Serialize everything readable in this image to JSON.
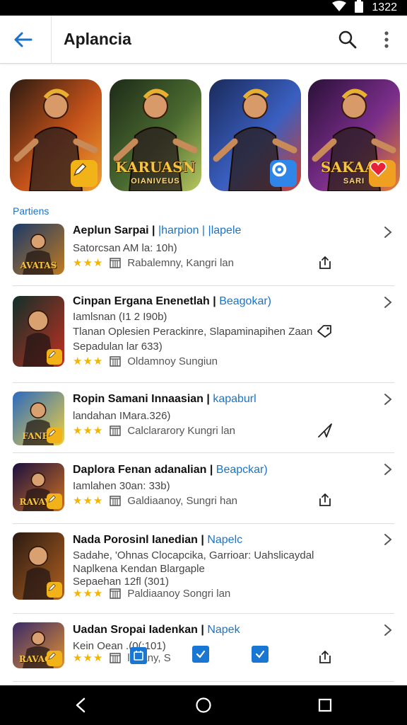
{
  "status_bar": {
    "time": "1322"
  },
  "app_bar": {
    "title": "Aplancia"
  },
  "banners": [
    {
      "text": "",
      "sub": "",
      "badge": "pen-icon",
      "badge_color": "#f2b318",
      "bg": [
        "#2a1a12",
        "#c4521a",
        "#f0a030"
      ]
    },
    {
      "text": "KARUASN",
      "sub": "OIANIVEUS",
      "badge": "",
      "badge_color": "",
      "bg": [
        "#1d2a18",
        "#4a6a30",
        "#b8c860"
      ]
    },
    {
      "text": "",
      "sub": "",
      "badge": "gear-icon",
      "badge_color": "#2f86e8",
      "bg": [
        "#1a2a5a",
        "#3a5fc0",
        "#d04030"
      ]
    },
    {
      "text": "SAKAAR",
      "sub": "SARI",
      "badge": "heart-icon",
      "badge_color": "#f0a020",
      "bg": [
        "#2a1038",
        "#7a2e8a",
        "#e88030"
      ]
    }
  ],
  "section": {
    "label": "Partiens"
  },
  "apps": [
    {
      "title": "Aeplun Sarpai |",
      "tag": "|harpion | |lapele",
      "lines": [
        "Satorcsan AM la: 10h)"
      ],
      "stars": "★★★",
      "category": "Rabalemny, Kangri lan",
      "action_icon": "share-box-icon",
      "thumb_text": "AVATAS",
      "thumb_badge": "",
      "thumb_bg": [
        "#1a3a6a",
        "#c07a20"
      ]
    },
    {
      "title": "Cinpan Ergana Enenetlah |",
      "tag": "Beagokar)",
      "lines": [
        "Iamlsnan (I1 2 I90b)",
        "Tlanan Oplesien Perackinre, Slapaminapihen Zaan",
        "Sepadulan lar 633)"
      ],
      "stars": "★★★",
      "category": "Oldamnoy Sungiun",
      "action_icon": "tag-icon",
      "thumb_text": "",
      "thumb_badge": "pen-icon",
      "thumb_bg": [
        "#10302a",
        "#c03020"
      ]
    },
    {
      "title": "Ropin Samani Innaasian |",
      "tag": "kapaburl",
      "lines": [
        "landahan IMara.326)"
      ],
      "stars": "★★★",
      "category": "Calclararory Kungri lan",
      "action_icon": "send-icon",
      "thumb_text": "FANES",
      "thumb_badge": "pen-icon",
      "thumb_bg": [
        "#2a6ac0",
        "#f0d040"
      ]
    },
    {
      "title": "Daplora Fenan adanalian |",
      "tag": "Beapckar)",
      "lines": [
        "Iamlahen 30an: 33b)"
      ],
      "stars": "★★★",
      "category": "Galdiaanoy, Sungri han",
      "action_icon": "share-box-icon",
      "thumb_text": "RAVAVE",
      "thumb_badge": "pen-icon",
      "thumb_bg": [
        "#1a1040",
        "#d07020"
      ]
    },
    {
      "title": "Nada Porosinl Ianedian |",
      "tag": "Napelc",
      "lines": [
        "Sadahe, 'Ohnas Clocapcika, Garrioar: Uahslicaydal",
        "Naplkena Kendan Blargaple",
        "Sepaehan 12fl (301)"
      ],
      "stars": "★★★",
      "category": "Paldiaanoy Songri lan",
      "action_icon": "",
      "thumb_text": "",
      "thumb_badge": "pen-icon",
      "thumb_bg": [
        "#2a1a12",
        "#b06020"
      ]
    },
    {
      "title": "Uadan Sropai Iadenkan |",
      "tag": "Napek",
      "lines": [
        "Kein Oean .(0(:101)"
      ],
      "stars": "★★★",
      "category": "llarany, S",
      "action_icon": "share-box-icon",
      "thumb_text": "RAVAGS",
      "thumb_badge": "pen-icon",
      "thumb_bg": [
        "#3a2a6a",
        "#e09030"
      ]
    }
  ],
  "colors": {
    "accent": "#1a73c8",
    "star": "#f5b400"
  }
}
